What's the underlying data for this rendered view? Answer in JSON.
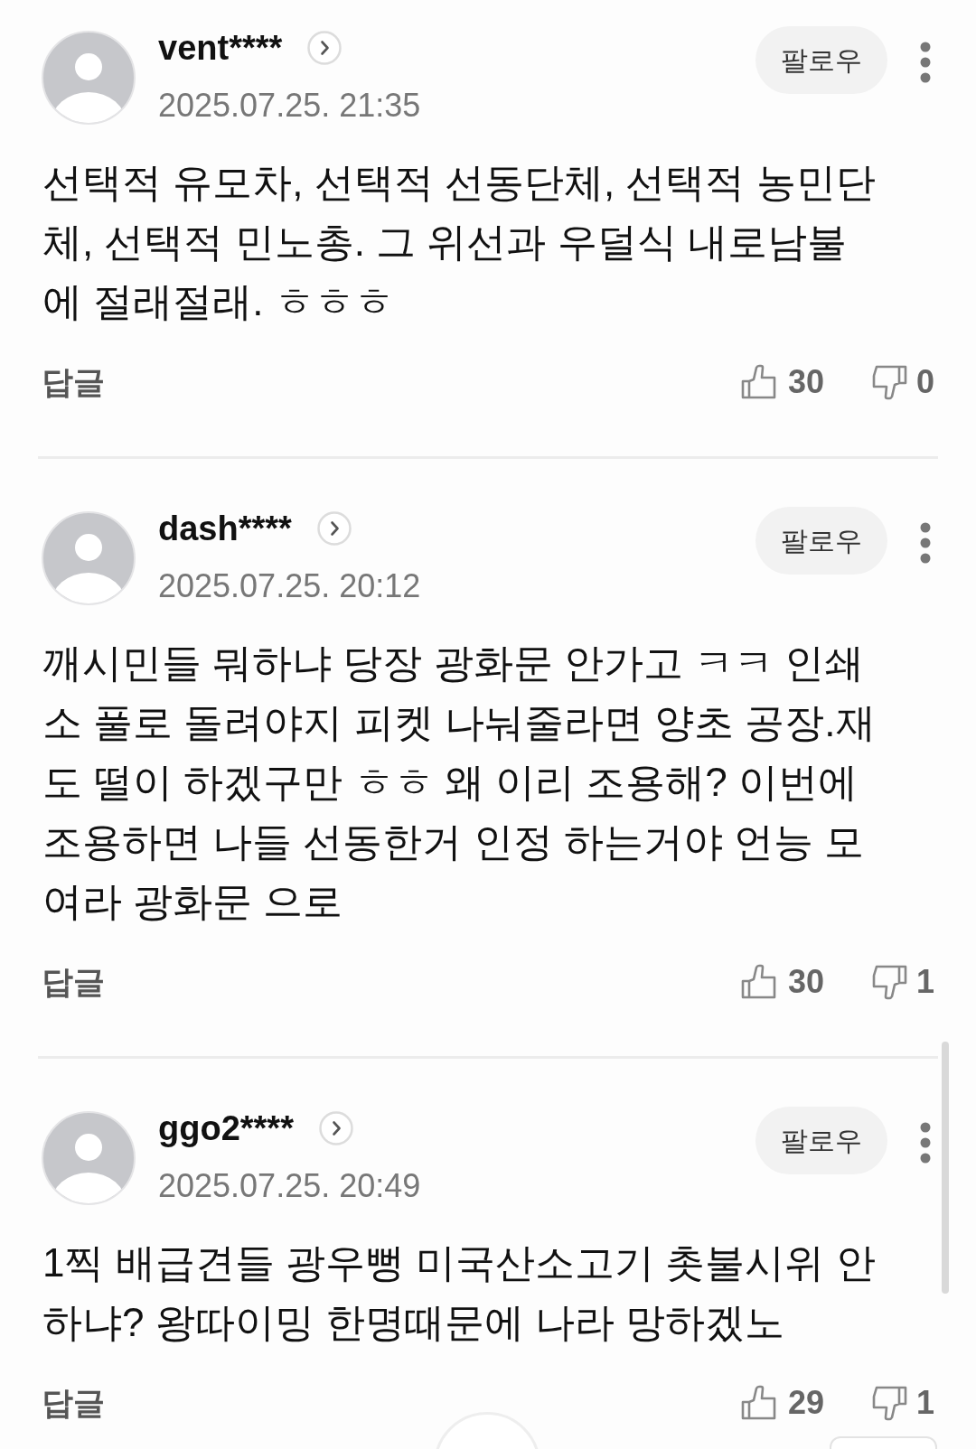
{
  "comments": [
    {
      "username": "vent****",
      "date": "2025.07.25. 21:35",
      "follow_label": "팔로우",
      "text": "선택적 유모차, 선택적 선동단체, 선택적 농민단체, 선택적 민노총. 그 위선과 우덜식 내로남불에 절래절래. ㅎㅎㅎ",
      "reply_label": "답글",
      "likes": "30",
      "dislikes": "0"
    },
    {
      "username": "dash****",
      "date": "2025.07.25. 20:12",
      "follow_label": "팔로우",
      "text": "깨시민들 뭐하냐 당장 광화문 안가고 ㅋㅋ 인쇄소 풀로 돌려야지 피켓 나눠줄라면 양초 공장.재도 떨이 하겠구만 ㅎㅎ 왜 이리 조용해? 이번에 조용하면 나들 선동한거 인정 하는거야 언능 모여라 광화문 으로",
      "reply_label": "답글",
      "likes": "30",
      "dislikes": "1"
    },
    {
      "username": "ggo2****",
      "date": "2025.07.25. 20:49",
      "follow_label": "팔로우",
      "text": "1찍 배급견들 광우뻥 미국산소고기 촛불시위 안하냐? 왕따이밍 한명때문에 나라 망하겠노",
      "reply_label": "답글",
      "likes": "29",
      "dislikes": "1"
    }
  ]
}
